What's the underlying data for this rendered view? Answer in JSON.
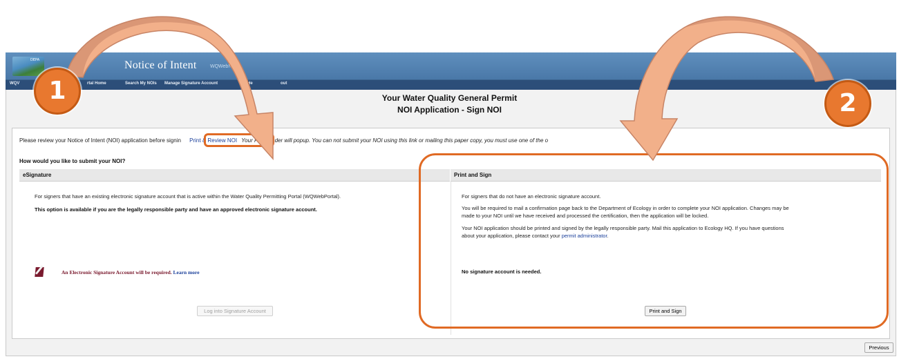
{
  "banner": {
    "logo_text": "DEPA",
    "app_title": "Notice of Intent",
    "app_subtitle": "WQWebNOI"
  },
  "nav": {
    "items": [
      "WQV",
      "rtal Home",
      "Search My NOIs",
      "Manage Signature Account",
      "He",
      "out"
    ]
  },
  "header": {
    "title": "Your Water Quality General Permit",
    "subtitle": "NOI Application - Sign NOI"
  },
  "review": {
    "prefix": "Please review your Notice of Intent (NOI) application before signin",
    "link": "Print & Review NOI",
    "suffix": "Your PDF reader will popup. You can not submit your NOI using this link or mailing this paper copy, you must use one of the o"
  },
  "question": "How would you like to submit your NOI?",
  "esignature": {
    "heading": "eSignature",
    "desc": "For signers that have an existing electronic signature account that is active within the Water Quality Permitting Portal (WQWebPortal).",
    "note": "This option is available if you are the legally responsible party and have an approved electronic signature account.",
    "warning": "An Electronic Signature Account will be required.",
    "learn_more": "Learn more",
    "button": "Log into Signature Account"
  },
  "print_sign": {
    "heading": "Print and Sign",
    "p1": "For signers that do not have an electronic signature account.",
    "p2a": "You will be required to mail a confirmation page back to the Department of Ecology in order to complete your NOI application. Changes may be",
    "p2b": "made to your NOI until we have received and processed the certification, then the application will be locked.",
    "p3a": "Your NOI application should be printed and signed by the legally responsible party. Mail this application to Ecology HQ. If you have questions",
    "p3b": "about your application, please contact your",
    "p3_link": "permit administrator",
    "no_account": "No signature account is needed.",
    "button": "Print and Sign"
  },
  "footer": {
    "previous": "Previous"
  },
  "callouts": {
    "one": "1",
    "two": "2"
  },
  "colors": {
    "callout": "#e8782f",
    "callout_border": "#c45a14",
    "arrow_fill": "#f2b08a",
    "arrow_shade": "#c78466",
    "highlight": "#e06a24",
    "banner": "#5a88b7",
    "navbar": "#2c4e79"
  }
}
